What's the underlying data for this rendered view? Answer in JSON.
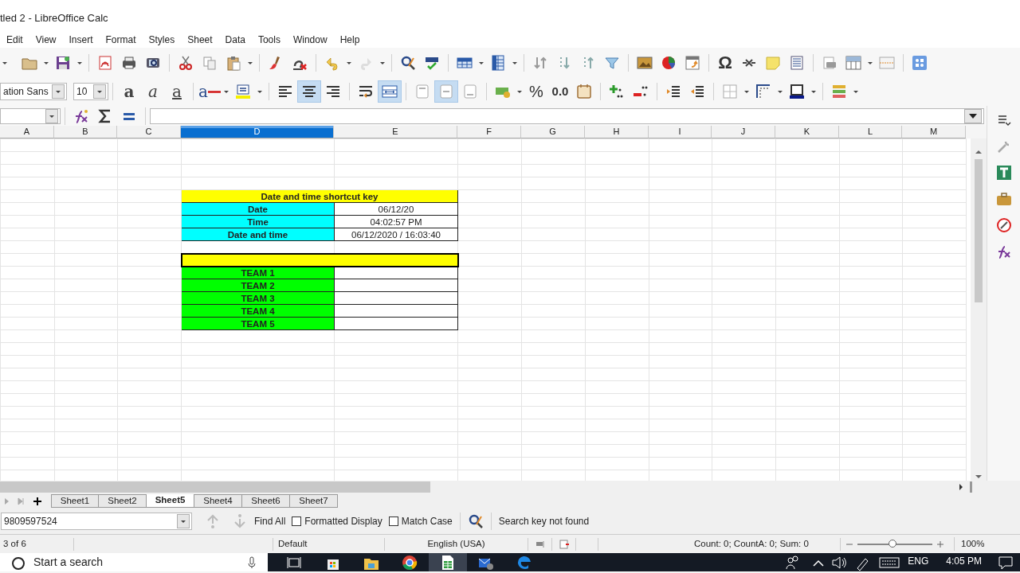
{
  "window": {
    "title": "tled 2 - LibreOffice Calc"
  },
  "menu": [
    "Edit",
    "View",
    "Insert",
    "Format",
    "Styles",
    "Sheet",
    "Data",
    "Tools",
    "Window",
    "Help"
  ],
  "toolbar": {
    "font_name": "ation Sans",
    "font_size": "10",
    "style_buttons": [
      {
        "kind": "bold",
        "label": "a"
      },
      {
        "kind": "italic",
        "label": "a"
      },
      {
        "kind": "underline",
        "label": "a"
      }
    ],
    "font_color_label": "a",
    "align_buttons": [
      {
        "on": false
      },
      {
        "on": true
      },
      {
        "on": false
      }
    ],
    "merge_on": true,
    "valign_buttons": [
      {
        "on": false
      },
      {
        "on": true
      },
      {
        "on": false
      }
    ],
    "percent": "%",
    "decimal": "0.0",
    "special_character": "Ω"
  },
  "columns": [
    {
      "label": "A",
      "selected": false
    },
    {
      "label": "B",
      "selected": false
    },
    {
      "label": "C",
      "selected": false
    },
    {
      "label": "D",
      "selected": true
    },
    {
      "label": "E",
      "selected": false
    },
    {
      "label": "F",
      "selected": false
    },
    {
      "label": "G",
      "selected": false
    },
    {
      "label": "H",
      "selected": false
    },
    {
      "label": "I",
      "selected": false
    },
    {
      "label": "J",
      "selected": false
    },
    {
      "label": "K",
      "selected": false
    },
    {
      "label": "L",
      "selected": false
    },
    {
      "label": "M",
      "selected": false
    }
  ],
  "info_table": {
    "title": {
      "text": "Date and time shortcut key",
      "color": "#ffff00"
    },
    "rows": [
      {
        "label": "Date",
        "value": "06/12/20",
        "color": "#00ffff"
      },
      {
        "label": "Time",
        "value": "04:02:57 PM",
        "color": "#00ffff"
      },
      {
        "label": "Date and time",
        "value": "06/12/2020 / 16:03:40",
        "color": "#00ffff"
      }
    ]
  },
  "team_table": {
    "header": {
      "color": "#ffff00",
      "selected": true
    },
    "rows": [
      {
        "label": "TEAM 1",
        "color": "#00ff00"
      },
      {
        "label": "TEAM 2",
        "color": "#00ff00"
      },
      {
        "label": "TEAM 3",
        "color": "#00ff00"
      },
      {
        "label": "TEAM 4",
        "color": "#00ff00"
      },
      {
        "label": "TEAM 5",
        "color": "#00ff00"
      }
    ]
  },
  "sheet_tabs": [
    {
      "label": "Sheet1",
      "selected": false
    },
    {
      "label": "Sheet2",
      "selected": false
    },
    {
      "label": "Sheet5",
      "selected": true
    },
    {
      "label": "Sheet4",
      "selected": false
    },
    {
      "label": "Sheet6",
      "selected": false
    },
    {
      "label": "Sheet7",
      "selected": false
    }
  ],
  "find_bar": {
    "value": "9809597524",
    "find_all": "Find All",
    "options": [
      {
        "label": "Formatted Display",
        "checked": false
      },
      {
        "label": "Match Case",
        "checked": false
      }
    ],
    "message": "Search key not found"
  },
  "status_bar": {
    "sheet": "3 of 6",
    "page_style": "Default",
    "language": "English (USA)",
    "summary": "Count: 0; CountA: 0; Sum: 0",
    "zoom": {
      "level": 0.47,
      "reading": "100%"
    }
  },
  "taskbar": {
    "search_placeholder": "Start a search",
    "language": "ENG",
    "time": "4:05 PM"
  }
}
